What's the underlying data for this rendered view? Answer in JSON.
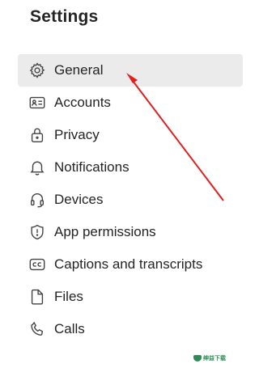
{
  "header": {
    "title": "Settings"
  },
  "menu": {
    "items": [
      {
        "label": "General",
        "icon": "gear-icon",
        "selected": true
      },
      {
        "label": "Accounts",
        "icon": "id-card-icon",
        "selected": false
      },
      {
        "label": "Privacy",
        "icon": "lock-icon",
        "selected": false
      },
      {
        "label": "Notifications",
        "icon": "bell-icon",
        "selected": false
      },
      {
        "label": "Devices",
        "icon": "headset-icon",
        "selected": false
      },
      {
        "label": "App permissions",
        "icon": "shield-icon",
        "selected": false
      },
      {
        "label": "Captions and transcripts",
        "icon": "closed-captions-icon",
        "selected": false
      },
      {
        "label": "Files",
        "icon": "document-icon",
        "selected": false
      },
      {
        "label": "Calls",
        "icon": "phone-icon",
        "selected": false
      }
    ]
  },
  "annotation": {
    "arrow_color": "#e02020"
  },
  "watermark": {
    "text": "绅益下载"
  },
  "colors": {
    "selected_background": "#ebebeb",
    "text": "#242424",
    "icon_stroke": "#424242"
  }
}
